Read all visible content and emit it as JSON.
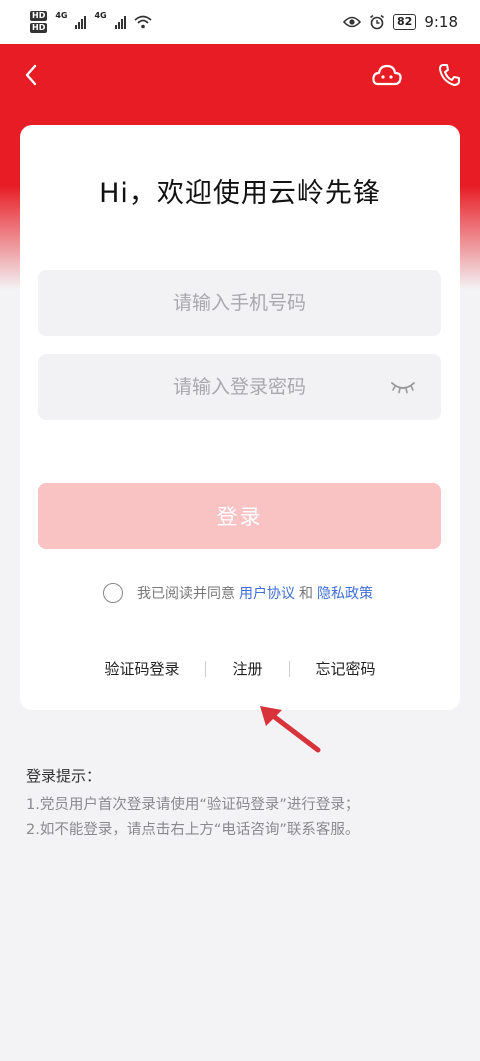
{
  "status_bar": {
    "hd1": "HD",
    "hd2": "HD",
    "net1": "4G",
    "net2": "4G",
    "battery": "82",
    "time": "9:18"
  },
  "nav": {
    "back_icon": "chevron-left-icon",
    "chat_icon": "cloud-chat-icon",
    "phone_icon": "phone-icon"
  },
  "login": {
    "title": "Hi，欢迎使用云岭先锋",
    "phone_placeholder": "请输入手机号码",
    "password_placeholder": "请输入登录密码",
    "login_button": "登录",
    "agree_text": "我已阅读并同意",
    "user_agreement": "用户协议",
    "and": "和",
    "privacy_policy": "隐私政策",
    "sms_login": "验证码登录",
    "register": "注册",
    "forgot_password": "忘记密码"
  },
  "tips": {
    "title": "登录提示：",
    "line1": "1.党员用户首次登录请使用“验证码登录”进行登录；",
    "line2": "2.如不能登录，请点击右上方“电话咨询”联系客服。"
  },
  "colors": {
    "brand_red": "#e81c24",
    "login_button_disabled": "#f9c3c4",
    "link_blue": "#3e6fd6",
    "annotation_arrow": "#d8323a"
  }
}
